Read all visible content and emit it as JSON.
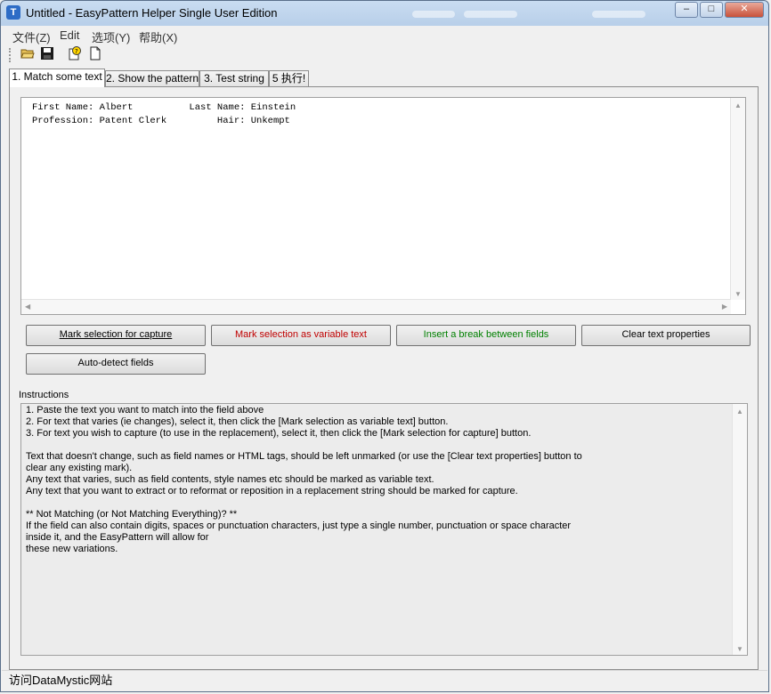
{
  "window": {
    "title": "Untitled - EasyPattern Helper Single User Edition",
    "minimize": "–",
    "maximize": "□",
    "close": "✕"
  },
  "menu": [
    "文件(Z)",
    "Edit",
    "选项(Y)",
    "帮助(X)"
  ],
  "toolbar": {
    "icons": [
      "open-folder-icon",
      "save-icon",
      "help-icon",
      "new-document-icon"
    ]
  },
  "tabs": [
    "1. Match some text",
    "2. Show the pattern",
    "3. Test string",
    "5 执行!"
  ],
  "sample": {
    "lines": [
      "First Name: Albert          Last Name: Einstein",
      "Profession: Patent Clerk         Hair: Unkempt"
    ]
  },
  "buttons": {
    "mark_capture": "Mark selection for capture",
    "mark_variable": "Mark selection as variable text",
    "insert_break": "Insert a break between fields",
    "clear_props": "Clear text properties",
    "auto_detect": "Auto-detect fields"
  },
  "colors": {
    "mark_variable": "#c00000",
    "insert_break": "#008000"
  },
  "instructions": {
    "label": "Instructions",
    "lines": [
      "1. Paste the text you want to match into the field above",
      "2. For text that varies (ie changes), select it, then click the [Mark selection as variable text] button.",
      "3. For text you wish to capture (to use in the replacement), select it, then click the [Mark selection for capture] button.",
      "",
      "Text that doesn't change, such as field names or HTML tags, should be left unmarked (or use the [Clear text properties] button to",
      "clear any existing mark).",
      "Any text that varies, such as field contents, style names etc should be marked as variable text.",
      "Any text that you want to extract or to reformat or reposition in a replacement string should be marked for capture.",
      "",
      "** Not Matching (or Not Matching Everything)? **",
      "If the field can also contain digits, spaces or punctuation characters, just type a single number, punctuation or space character",
      "inside it, and the EasyPattern will allow for",
      "these new variations."
    ]
  },
  "status": "访问DataMystic网站"
}
